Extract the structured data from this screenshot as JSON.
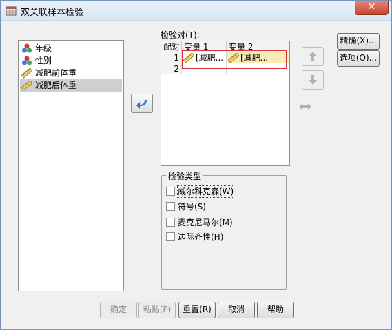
{
  "window": {
    "title": "双关联样本检验",
    "close_glyph": "✕"
  },
  "variables": [
    {
      "label": "年级",
      "icon": "nominal-balls-icon",
      "selected": false
    },
    {
      "label": "性别",
      "icon": "nominal-balls-icon",
      "selected": false
    },
    {
      "label": "减肥前体重",
      "icon": "scale-ruler-icon",
      "selected": false
    },
    {
      "label": "减肥后体重",
      "icon": "scale-ruler-icon",
      "selected": true
    }
  ],
  "test_pairs": {
    "label": "检验对(T):",
    "columns": [
      "配对",
      "变量 1",
      "变量 2"
    ],
    "rows": [
      {
        "num": "1",
        "var1": "[减肥...",
        "var2": "[减肥..."
      },
      {
        "num": "2",
        "var1": "",
        "var2": ""
      }
    ]
  },
  "side_buttons": {
    "exact": "精确(X)...",
    "options": "选项(O)..."
  },
  "test_type": {
    "title": "检验类型",
    "items": [
      {
        "label": "威尔科克森(W)",
        "checked": false
      },
      {
        "label": "符号(S)",
        "checked": false
      },
      {
        "label": "麦克尼马尔(M)",
        "checked": false
      },
      {
        "label": "边际齐性(H)",
        "checked": false
      }
    ]
  },
  "bottom_buttons": {
    "ok": "确定",
    "paste": "粘贴(P)",
    "reset": "重置(R)",
    "cancel": "取消",
    "help": "帮助"
  },
  "colors": {
    "highlight": "#fdebb5",
    "annotation": "#d9353a",
    "arrow": "#2f6fbf"
  }
}
